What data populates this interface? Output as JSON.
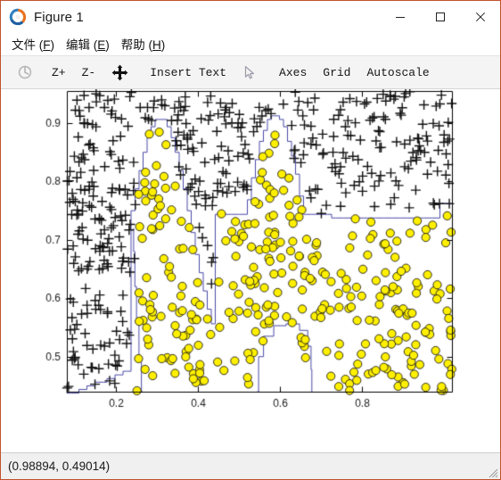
{
  "window": {
    "title": "Figure 1",
    "icon": "octave-logo-icon",
    "border_color": "#c1522c",
    "controls": [
      {
        "name": "minimize-button",
        "glyph": "minimize-icon"
      },
      {
        "name": "maximize-button",
        "glyph": "maximize-icon"
      },
      {
        "name": "close-button",
        "glyph": "close-icon"
      }
    ]
  },
  "menubar": {
    "items": [
      {
        "label": "文件 (F)",
        "text": "文件 (",
        "mnemonic": "F",
        "tail": ")",
        "name": "menu-file"
      },
      {
        "label": "编辑 (E)",
        "text": "编辑 (",
        "mnemonic": "E",
        "tail": ")",
        "name": "menu-edit"
      },
      {
        "label": "帮助 (H)",
        "text": "帮助 (",
        "mnemonic": "H",
        "tail": ")",
        "name": "menu-help"
      }
    ]
  },
  "toolbar": {
    "items": [
      {
        "label": "",
        "icon": "rotate-reset-icon",
        "name": "toolbar-rotate",
        "enabled": false
      },
      {
        "label": "Z+",
        "icon": "zoom-in-icon",
        "name": "toolbar-zoom-in",
        "enabled": true
      },
      {
        "label": "Z-",
        "icon": "zoom-out-icon",
        "name": "toolbar-zoom-out",
        "enabled": true
      },
      {
        "label": "",
        "icon": "pan-move-icon",
        "name": "toolbar-pan",
        "enabled": true
      },
      {
        "label": "Insert Text",
        "icon": "text-icon",
        "name": "toolbar-insert-text",
        "enabled": true
      },
      {
        "label": "",
        "icon": "cursor-pointer-icon",
        "name": "toolbar-select",
        "enabled": true
      },
      {
        "label": "Axes",
        "icon": "axes-icon",
        "name": "toolbar-axes",
        "enabled": true
      },
      {
        "label": "Grid",
        "icon": "grid-icon",
        "name": "toolbar-grid",
        "enabled": true
      },
      {
        "label": "Autoscale",
        "icon": "autoscale-icon",
        "name": "toolbar-autoscale",
        "enabled": true
      }
    ]
  },
  "statusbar": {
    "coordinates": "(0.98894, 0.49014)"
  },
  "chart_data": {
    "type": "scatter",
    "title": "",
    "xlabel": "",
    "ylabel": "",
    "xlim": [
      0.08,
      1.02
    ],
    "ylim": [
      0.44,
      0.955
    ],
    "xticks": [
      0.2,
      0.4,
      0.6,
      0.8
    ],
    "xticklabels": [
      "0.2",
      "0.4",
      "0.6",
      "0.8"
    ],
    "yticks": [
      0.5,
      0.6,
      0.7,
      0.8,
      0.9
    ],
    "yticklabels": [
      "0.5",
      "0.6",
      "0.7",
      "0.8",
      "0.9"
    ],
    "grid": false,
    "legend": null,
    "box": true,
    "background": "#ffffff",
    "series": [
      {
        "name": "class-negative",
        "marker": "plus",
        "color": "#111111",
        "size": 5.5,
        "linewidth": 1.4,
        "count": 430,
        "description": "Black plus markers located outside the blue decision-boundary contour"
      },
      {
        "name": "class-positive",
        "marker": "circle-filled",
        "facecolor": "#fff000",
        "edgecolor": "#1a1a1a",
        "size": 4.6,
        "count": 330,
        "description": "Yellow filled circles located inside the blue decision-boundary contour"
      }
    ],
    "contour": {
      "name": "decision-boundary",
      "color": "#4a4aa8",
      "linewidth": 1.0,
      "description": "Stepped polyline separating yellow circle region (below/inside) from black plus region (above/outside). Two lobes peak near x=0.30 (y≈0.87) and x=0.58 (y≈0.88), with a saddle dip near x=0.46 (y≈0.74), a descending tail to the right reaching y≈0.73 at x=0.75 and y≈0.76 at x=1.0, a left edge falling near x=0.24, and a small enclosed notch near x=0.58-0.70 at the bottom."
    }
  }
}
